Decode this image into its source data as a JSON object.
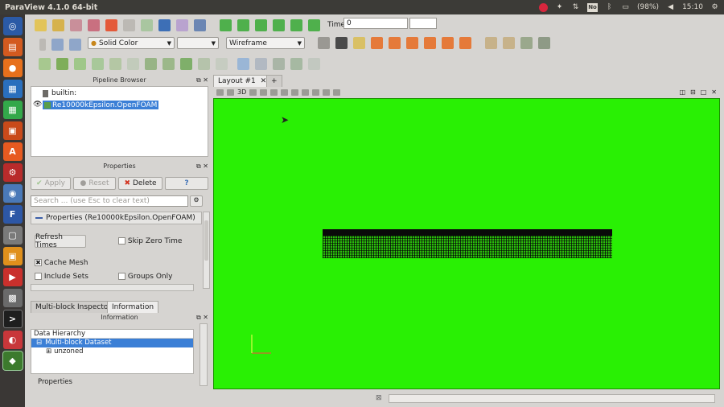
{
  "window": {
    "title": "ParaView 4.1.0 64-bit"
  },
  "tray": {
    "battery": "(98%)",
    "time": "15:10",
    "no_label": "No"
  },
  "toolbar": {
    "time_label": "Time:",
    "time_value": "0",
    "color_select": "Solid Color",
    "representation_select": "Wireframe"
  },
  "pipeline": {
    "header": "Pipeline Browser",
    "root": "builtin:",
    "source": "Re10000kEpsilon.OpenFOAM"
  },
  "properties": {
    "header": "Properties",
    "apply": "Apply",
    "reset": "Reset",
    "delete": "Delete",
    "help": "?",
    "search_placeholder": "Search ... (use Esc to clear text)",
    "section": "Properties (Re10000kEpsilon.OpenFOAM)",
    "refresh_times": "Refresh Times",
    "skip_zero_time": "Skip Zero Time",
    "cache_mesh": "Cache Mesh",
    "include_sets": "Include Sets",
    "groups_only": "Groups Only"
  },
  "info_tabs": {
    "tab1": "Multi-block Inspector",
    "tab2": "Information"
  },
  "information": {
    "header": "Information",
    "data_hierarchy": "Data Hierarchy",
    "dataset": "Multi-block Dataset",
    "child": "unzoned",
    "properties": "Properties"
  },
  "layout": {
    "tab": "Layout #1",
    "add": "+",
    "view_mode": "3D"
  },
  "colors": {
    "viewport": "#29f004",
    "selection": "#3b7fd6"
  }
}
